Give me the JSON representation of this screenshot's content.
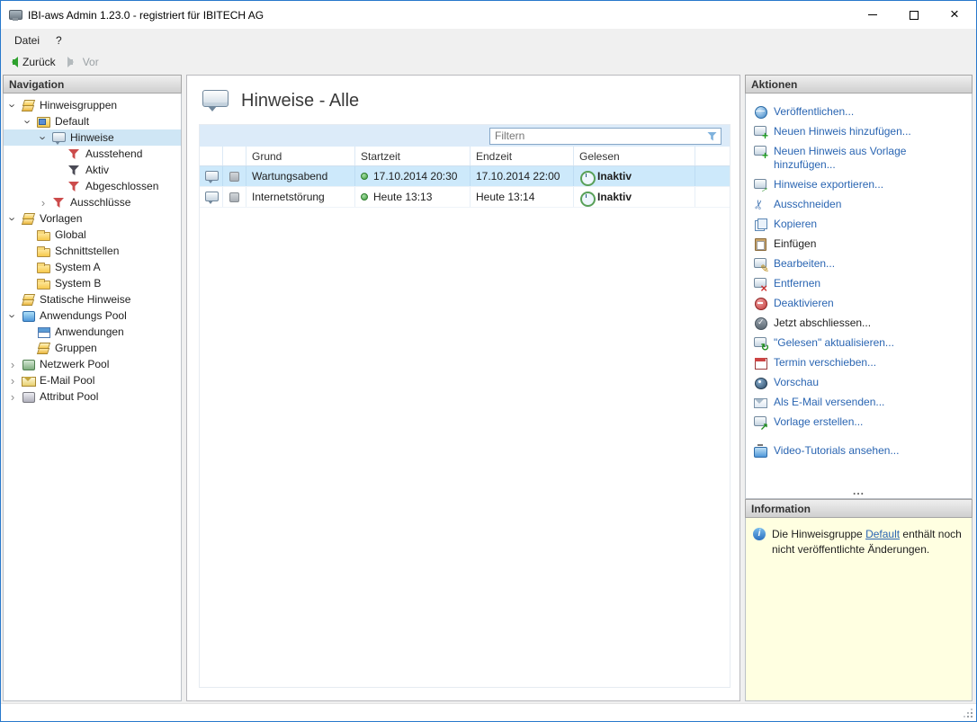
{
  "window": {
    "title": "IBI-aws Admin 1.23.0 - registriert für IBITECH AG"
  },
  "menubar": {
    "items": [
      "Datei",
      "?"
    ]
  },
  "toolbar": {
    "back_label": "Zurück",
    "forward_label": "Vor"
  },
  "navigation": {
    "header": "Navigation",
    "tree": [
      {
        "label": "Hinweisgruppen",
        "level": 0,
        "expander": "down",
        "icon": "layers-yellow"
      },
      {
        "label": "Default",
        "level": 1,
        "expander": "down",
        "icon": "group-folder"
      },
      {
        "label": "Hinweise",
        "level": 2,
        "expander": "down",
        "icon": "note-bubble",
        "selected": true
      },
      {
        "label": "Ausstehend",
        "level": 3,
        "expander": "none",
        "icon": "filter-red"
      },
      {
        "label": "Aktiv",
        "level": 3,
        "expander": "none",
        "icon": "filter-dark"
      },
      {
        "label": "Abgeschlossen",
        "level": 3,
        "expander": "none",
        "icon": "filter-red"
      },
      {
        "label": "Ausschlüsse",
        "level": 2,
        "expander": "right",
        "icon": "filter-red"
      },
      {
        "label": "Vorlagen",
        "level": 0,
        "expander": "down",
        "icon": "layers-yellow"
      },
      {
        "label": "Global",
        "level": 1,
        "expander": "none",
        "icon": "folder"
      },
      {
        "label": "Schnittstellen",
        "level": 1,
        "expander": "none",
        "icon": "folder"
      },
      {
        "label": "System A",
        "level": 1,
        "expander": "none",
        "icon": "folder"
      },
      {
        "label": "System B",
        "level": 1,
        "expander": "none",
        "icon": "folder"
      },
      {
        "label": "Statische Hinweise",
        "level": 0,
        "expander": "none",
        "icon": "layers-yellow"
      },
      {
        "label": "Anwendungs Pool",
        "level": 0,
        "expander": "down",
        "icon": "pool-blue"
      },
      {
        "label": "Anwendungen",
        "level": 1,
        "expander": "none",
        "icon": "app-window"
      },
      {
        "label": "Gruppen",
        "level": 1,
        "expander": "none",
        "icon": "layers-yellow"
      },
      {
        "label": "Netzwerk Pool",
        "level": 0,
        "expander": "right",
        "icon": "pool-network"
      },
      {
        "label": "E-Mail Pool",
        "level": 0,
        "expander": "right",
        "icon": "pool-mail"
      },
      {
        "label": "Attribut Pool",
        "level": 0,
        "expander": "right",
        "icon": "pool-attr"
      }
    ]
  },
  "main": {
    "title": "Hinweise - Alle",
    "filter": {
      "placeholder": "Filtern"
    },
    "table": {
      "columns": [
        "Grund",
        "Startzeit",
        "Endzeit",
        "Gelesen"
      ],
      "rows": [
        {
          "grund": "Wartungsabend",
          "startzeit": "17.10.2014 20:30",
          "endzeit": "17.10.2014 22:00",
          "gelesen": "Inaktiv",
          "selected": true
        },
        {
          "grund": "Internetstörung",
          "startzeit": "Heute 13:13",
          "endzeit": "Heute 13:14",
          "gelesen": "Inaktiv",
          "selected": false
        }
      ]
    }
  },
  "actions": {
    "header": "Aktionen",
    "items": [
      {
        "label": "Veröffentlichen...",
        "icon": "publish"
      },
      {
        "label": "Neuen Hinweis hinzufügen...",
        "icon": "note-add"
      },
      {
        "label": "Neuen Hinweis aus Vorlage hinzufügen...",
        "icon": "note-add-template"
      },
      {
        "label": "Hinweise exportieren...",
        "icon": "note-export"
      },
      {
        "label": "Ausschneiden",
        "icon": "cut"
      },
      {
        "label": "Kopieren",
        "icon": "copy"
      },
      {
        "label": "Einfügen",
        "icon": "paste",
        "style": "plain"
      },
      {
        "label": "Bearbeiten...",
        "icon": "edit"
      },
      {
        "label": "Entfernen",
        "icon": "remove"
      },
      {
        "label": "Deaktivieren",
        "icon": "deactivate"
      },
      {
        "label": "Jetzt abschliessen...",
        "icon": "finish",
        "style": "plain"
      },
      {
        "label": "\"Gelesen\" aktualisieren...",
        "icon": "refresh-read"
      },
      {
        "label": "Termin verschieben...",
        "icon": "reschedule"
      },
      {
        "label": "Vorschau",
        "icon": "preview"
      },
      {
        "label": "Als E-Mail versenden...",
        "icon": "send-mail"
      },
      {
        "label": "Vorlage erstellen...",
        "icon": "create-template"
      },
      {
        "label": "Video-Tutorials ansehen...",
        "icon": "video-tutorials",
        "gap_before": true
      }
    ],
    "overflow": "..."
  },
  "information": {
    "header": "Information",
    "text_before": "Die Hinweisgruppe ",
    "link_text": "Default",
    "text_after": " enthält noch nicht veröffentlichte Änderungen."
  }
}
